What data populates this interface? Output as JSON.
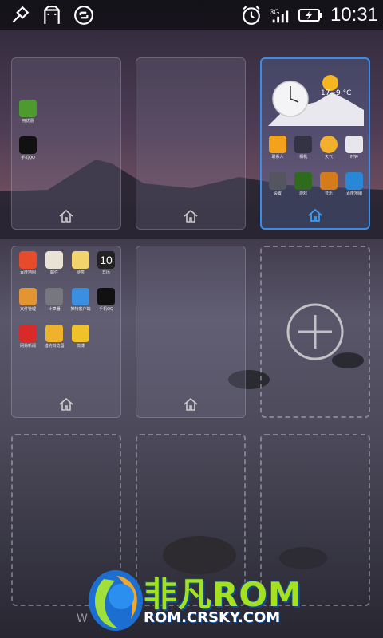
{
  "status_bar": {
    "time": "10:31",
    "network": "3G",
    "left_icons": [
      "usb-debug-icon",
      "notification-icon",
      "sync-icon"
    ],
    "right_icons": [
      "alarm-icon",
      "signal-icon",
      "battery-charging-icon"
    ]
  },
  "screens": [
    {
      "apps": [
        {
          "label": "用优惠",
          "color": "#4d9a2f"
        },
        {
          "label": "手机QQ",
          "color": "#111111"
        }
      ]
    },
    {
      "apps": []
    },
    {
      "active": true,
      "weather": {
        "temp": "17~9 °C"
      },
      "apps": [
        {
          "label": "联系人",
          "color": "#f2a21b"
        },
        {
          "label": "相机",
          "color": "#333344"
        },
        {
          "label": "天气",
          "color": "#f3b02a"
        },
        {
          "label": "时钟",
          "color": "#e6e6ec"
        },
        {
          "label": "设置",
          "color": "#555560"
        },
        {
          "label": "游戏",
          "color": "#2e6b1c"
        },
        {
          "label": "音乐",
          "color": "#d47b1c"
        },
        {
          "label": "百度地图",
          "color": "#2a86d6"
        }
      ]
    },
    {
      "apps": [
        {
          "label": "百度地图",
          "color": "#e84b2c"
        },
        {
          "label": "邮件",
          "color": "#e9e3d5"
        },
        {
          "label": "便签",
          "color": "#f2d36c"
        },
        {
          "label": "日历",
          "color": "#222222",
          "text": "10"
        },
        {
          "label": "文件管理",
          "color": "#e29532"
        },
        {
          "label": "计算器",
          "color": "#777780"
        },
        {
          "label": "推特客户端",
          "color": "#3a8fe0"
        },
        {
          "label": "手机QQ",
          "color": "#111111"
        },
        {
          "label": "网易新闻",
          "color": "#d92a2a"
        },
        {
          "label": "猎豹浏览器",
          "color": "#f0b22a"
        },
        {
          "label": "微博",
          "color": "#f0c22a"
        }
      ]
    },
    {
      "apps": []
    },
    {
      "add_screen": true
    },
    {
      "empty": true
    },
    {
      "empty": true
    },
    {
      "empty": true
    }
  ],
  "watermark": {
    "title": "非凡ROM",
    "subtitle": "ROM.CRSKY.COM",
    "small_text": "W"
  }
}
